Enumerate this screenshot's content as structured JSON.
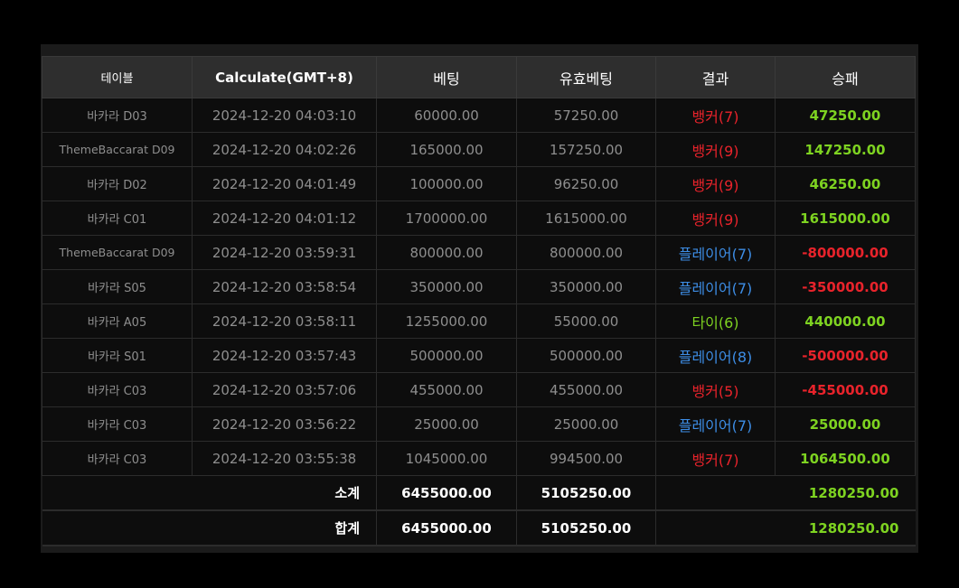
{
  "headers": {
    "table": "테이블",
    "calculate": "Calculate(GMT+8)",
    "bet": "베팅",
    "valid_bet": "유효베팅",
    "result": "결과",
    "win_loss": "승패"
  },
  "rows": [
    {
      "table": "바카라 D03",
      "time": "2024-12-20 04:03:10",
      "bet": "60000.00",
      "valid": "57250.00",
      "result": "뱅커(7)",
      "winloss": "47250.00"
    },
    {
      "table": "ThemeBaccarat D09",
      "time": "2024-12-20 04:02:26",
      "bet": "165000.00",
      "valid": "157250.00",
      "result": "뱅커(9)",
      "winloss": "147250.00"
    },
    {
      "table": "바카라 D02",
      "time": "2024-12-20 04:01:49",
      "bet": "100000.00",
      "valid": "96250.00",
      "result": "뱅커(9)",
      "winloss": "46250.00"
    },
    {
      "table": "바카라 C01",
      "time": "2024-12-20 04:01:12",
      "bet": "1700000.00",
      "valid": "1615000.00",
      "result": "뱅커(9)",
      "winloss": "1615000.00"
    },
    {
      "table": "ThemeBaccarat D09",
      "time": "2024-12-20 03:59:31",
      "bet": "800000.00",
      "valid": "800000.00",
      "result": "플레이어(7)",
      "winloss": "-800000.00"
    },
    {
      "table": "바카라 S05",
      "time": "2024-12-20 03:58:54",
      "bet": "350000.00",
      "valid": "350000.00",
      "result": "플레이어(7)",
      "winloss": "-350000.00"
    },
    {
      "table": "바카라 A05",
      "time": "2024-12-20 03:58:11",
      "bet": "1255000.00",
      "valid": "55000.00",
      "result": "타이(6)",
      "winloss": "440000.00"
    },
    {
      "table": "바카라 S01",
      "time": "2024-12-20 03:57:43",
      "bet": "500000.00",
      "valid": "500000.00",
      "result": "플레이어(8)",
      "winloss": "-500000.00"
    },
    {
      "table": "바카라 C03",
      "time": "2024-12-20 03:57:06",
      "bet": "455000.00",
      "valid": "455000.00",
      "result": "뱅커(5)",
      "winloss": "-455000.00"
    },
    {
      "table": "바카라 C03",
      "time": "2024-12-20 03:56:22",
      "bet": "25000.00",
      "valid": "25000.00",
      "result": "플레이어(7)",
      "winloss": "25000.00"
    },
    {
      "table": "바카라 C03",
      "time": "2024-12-20 03:55:38",
      "bet": "1045000.00",
      "valid": "994500.00",
      "result": "뱅커(7)",
      "winloss": "1064500.00"
    }
  ],
  "subtotal": {
    "label": "소계",
    "bet": "6455000.00",
    "valid": "5105250.00",
    "winloss": "1280250.00"
  },
  "total": {
    "label": "합계",
    "bet": "6455000.00",
    "valid": "5105250.00",
    "winloss": "1280250.00"
  },
  "colors": {
    "banker": "#e8232b",
    "player": "#3d8de5",
    "tie": "#7ed321",
    "win": "#7ed321",
    "loss": "#e8232b"
  }
}
